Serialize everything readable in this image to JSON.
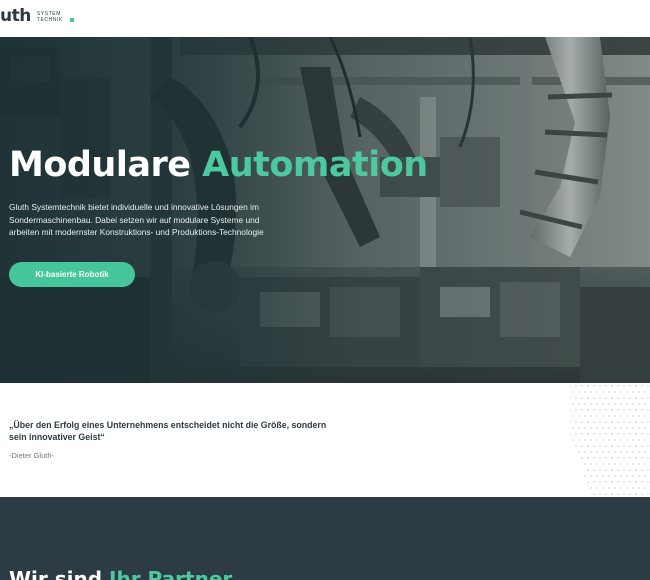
{
  "header": {
    "logo_word": "uth",
    "logo_sub_line1": "SYSTEM",
    "logo_sub_line2": "TECHNIK"
  },
  "hero": {
    "title_part1": "Modulare",
    "title_part2": "Automation",
    "description": "Gluth Systemtechnik bietet individuelle und innovative Lösungen im Sondermaschinenbau. Dabei setzen wir auf modulare Systeme und arbeiten mit modernster Konstruktions- und Produktions-Technologie",
    "button_label": "KI-basierte Robotik"
  },
  "quote": {
    "text": "„Über den Erfolg eines Unternehmens entscheidet nicht die Größe, sondern sein innovativer Geist“",
    "author": "-Dieter Gluth-"
  },
  "partner": {
    "title_part1": "Wir sind",
    "title_part2": "Ihr Partner"
  },
  "colors": {
    "accent": "#45c59a",
    "dark": "#2d3b44",
    "text": "#2b3a42"
  }
}
